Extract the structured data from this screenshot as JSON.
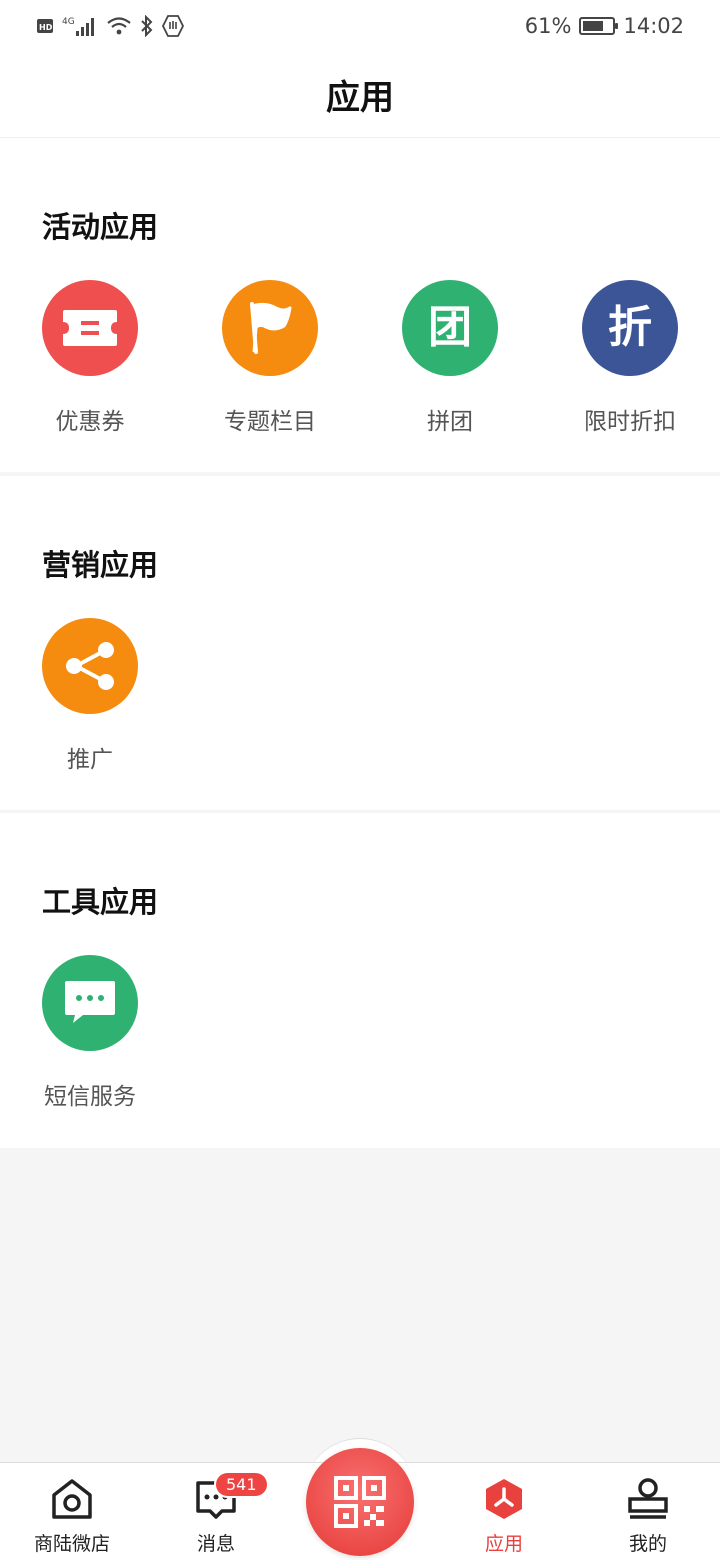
{
  "status_bar": {
    "network": "4G",
    "battery_text": "61%",
    "time": "14:02"
  },
  "header": {
    "title": "应用"
  },
  "sections": [
    {
      "title": "活动应用",
      "apps": [
        {
          "label": "优惠券",
          "icon": "ticket-icon",
          "color": "#ef4f4f"
        },
        {
          "label": "专题栏目",
          "icon": "flag-icon",
          "color": "#f68c0f"
        },
        {
          "label": "拼团",
          "icon": "group-buy-icon",
          "glyph": "团",
          "color": "#2fb172"
        },
        {
          "label": "限时折扣",
          "icon": "discount-icon",
          "glyph": "折",
          "color": "#3b5596"
        }
      ]
    },
    {
      "title": "营销应用",
      "apps": [
        {
          "label": "推广",
          "icon": "share-icon",
          "color": "#f68c0f"
        }
      ]
    },
    {
      "title": "工具应用",
      "apps": [
        {
          "label": "短信服务",
          "icon": "sms-icon",
          "color": "#2fb172"
        }
      ]
    }
  ],
  "bottom_nav": {
    "items": [
      {
        "label": "商陆微店",
        "icon": "home-icon"
      },
      {
        "label": "消息",
        "icon": "message-icon",
        "badge": "541"
      },
      {
        "label": "",
        "icon": "qr-scan-icon"
      },
      {
        "label": "应用",
        "icon": "apps-icon",
        "active": true
      },
      {
        "label": "我的",
        "icon": "profile-icon"
      }
    ],
    "accent": "#e8413e"
  }
}
